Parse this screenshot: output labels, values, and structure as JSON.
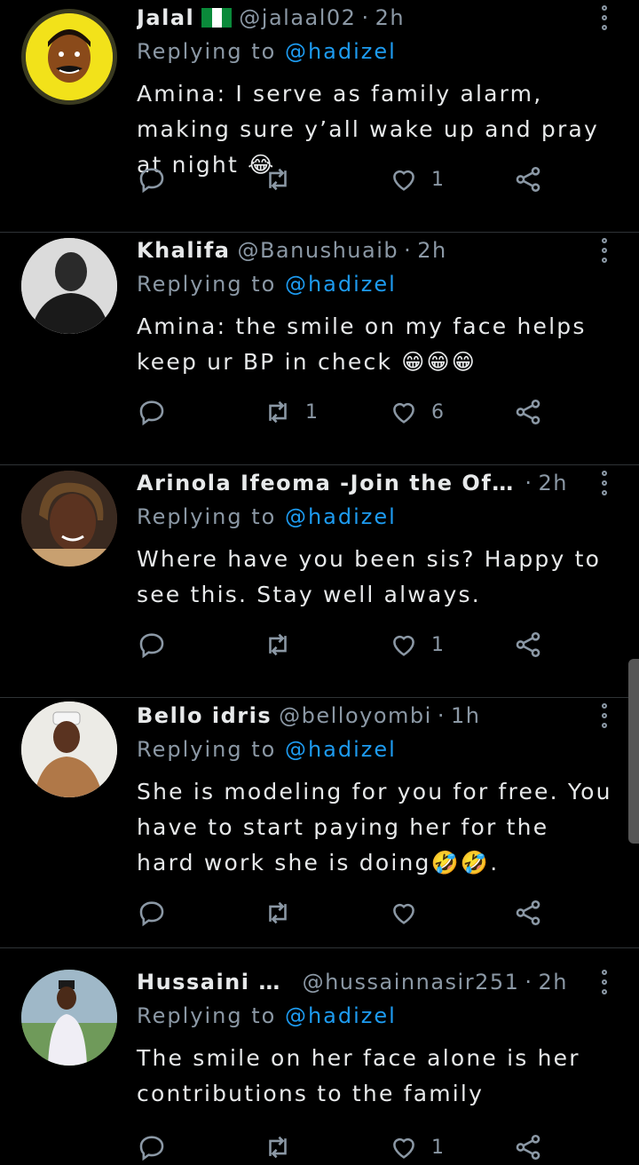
{
  "tweets": [
    {
      "name": "Jalal",
      "flag": true,
      "handle": "@jalaal02",
      "time": "2h",
      "reply_label": "Replying to",
      "reply_mention": "@hadizel",
      "text": "Amina: I serve as family alarm, making sure y’all wake up and pray at night 😂",
      "counts": {
        "reply": "",
        "retweet": "",
        "like": "1"
      },
      "avatar_color": "#f2e21a"
    },
    {
      "name": "Khalifa",
      "handle": "@Banushuaib",
      "time": "2h",
      "reply_label": "Replying to",
      "reply_mention": "@hadizel",
      "text": "Amina: the smile on my face helps keep ur BP in check 😁😁😁",
      "counts": {
        "reply": "",
        "retweet": "1",
        "like": "6"
      },
      "avatar_color": "#9a9a9a"
    },
    {
      "name": "Arinola Ifeoma -Join the Offic…",
      "handle": "",
      "time": "2h",
      "reply_label": "Replying to",
      "reply_mention": "@hadizel",
      "text": "Where have you been sis? Happy to see this. Stay well always.",
      "counts": {
        "reply": "",
        "retweet": "",
        "like": "1"
      },
      "avatar_color": "#5a3a2a"
    },
    {
      "name": "Bello idris",
      "handle": "@belloyombi",
      "time": "1h",
      "reply_label": "Replying to",
      "reply_mention": "@hadizel",
      "text": "She is modeling for you for free. You have to start paying her for the hard work she is doing🤣🤣.",
      "counts": {
        "reply": "",
        "retweet": "",
        "like": ""
      },
      "avatar_color": "#e8e4dc"
    },
    {
      "name": "Hussaini Nasir",
      "handle": "@hussainnasir251",
      "time": "2h",
      "reply_label": "Replying to",
      "reply_mention": "@hadizel",
      "text": "The smile on her face alone is her contributions to the family",
      "counts": {
        "reply": "",
        "retweet": "",
        "like": "1"
      },
      "avatar_color": "#7aa06a"
    }
  ],
  "colors": {
    "background": "#000000",
    "text": "#e7e9ea",
    "muted": "#8b98a5",
    "mention": "#1d9bf0",
    "divider": "#2f3336"
  },
  "icons": {
    "reply": "reply-bubble-icon",
    "retweet": "retweet-icon",
    "like": "heart-icon",
    "share": "share-icon",
    "more": "more-vertical-icon"
  }
}
